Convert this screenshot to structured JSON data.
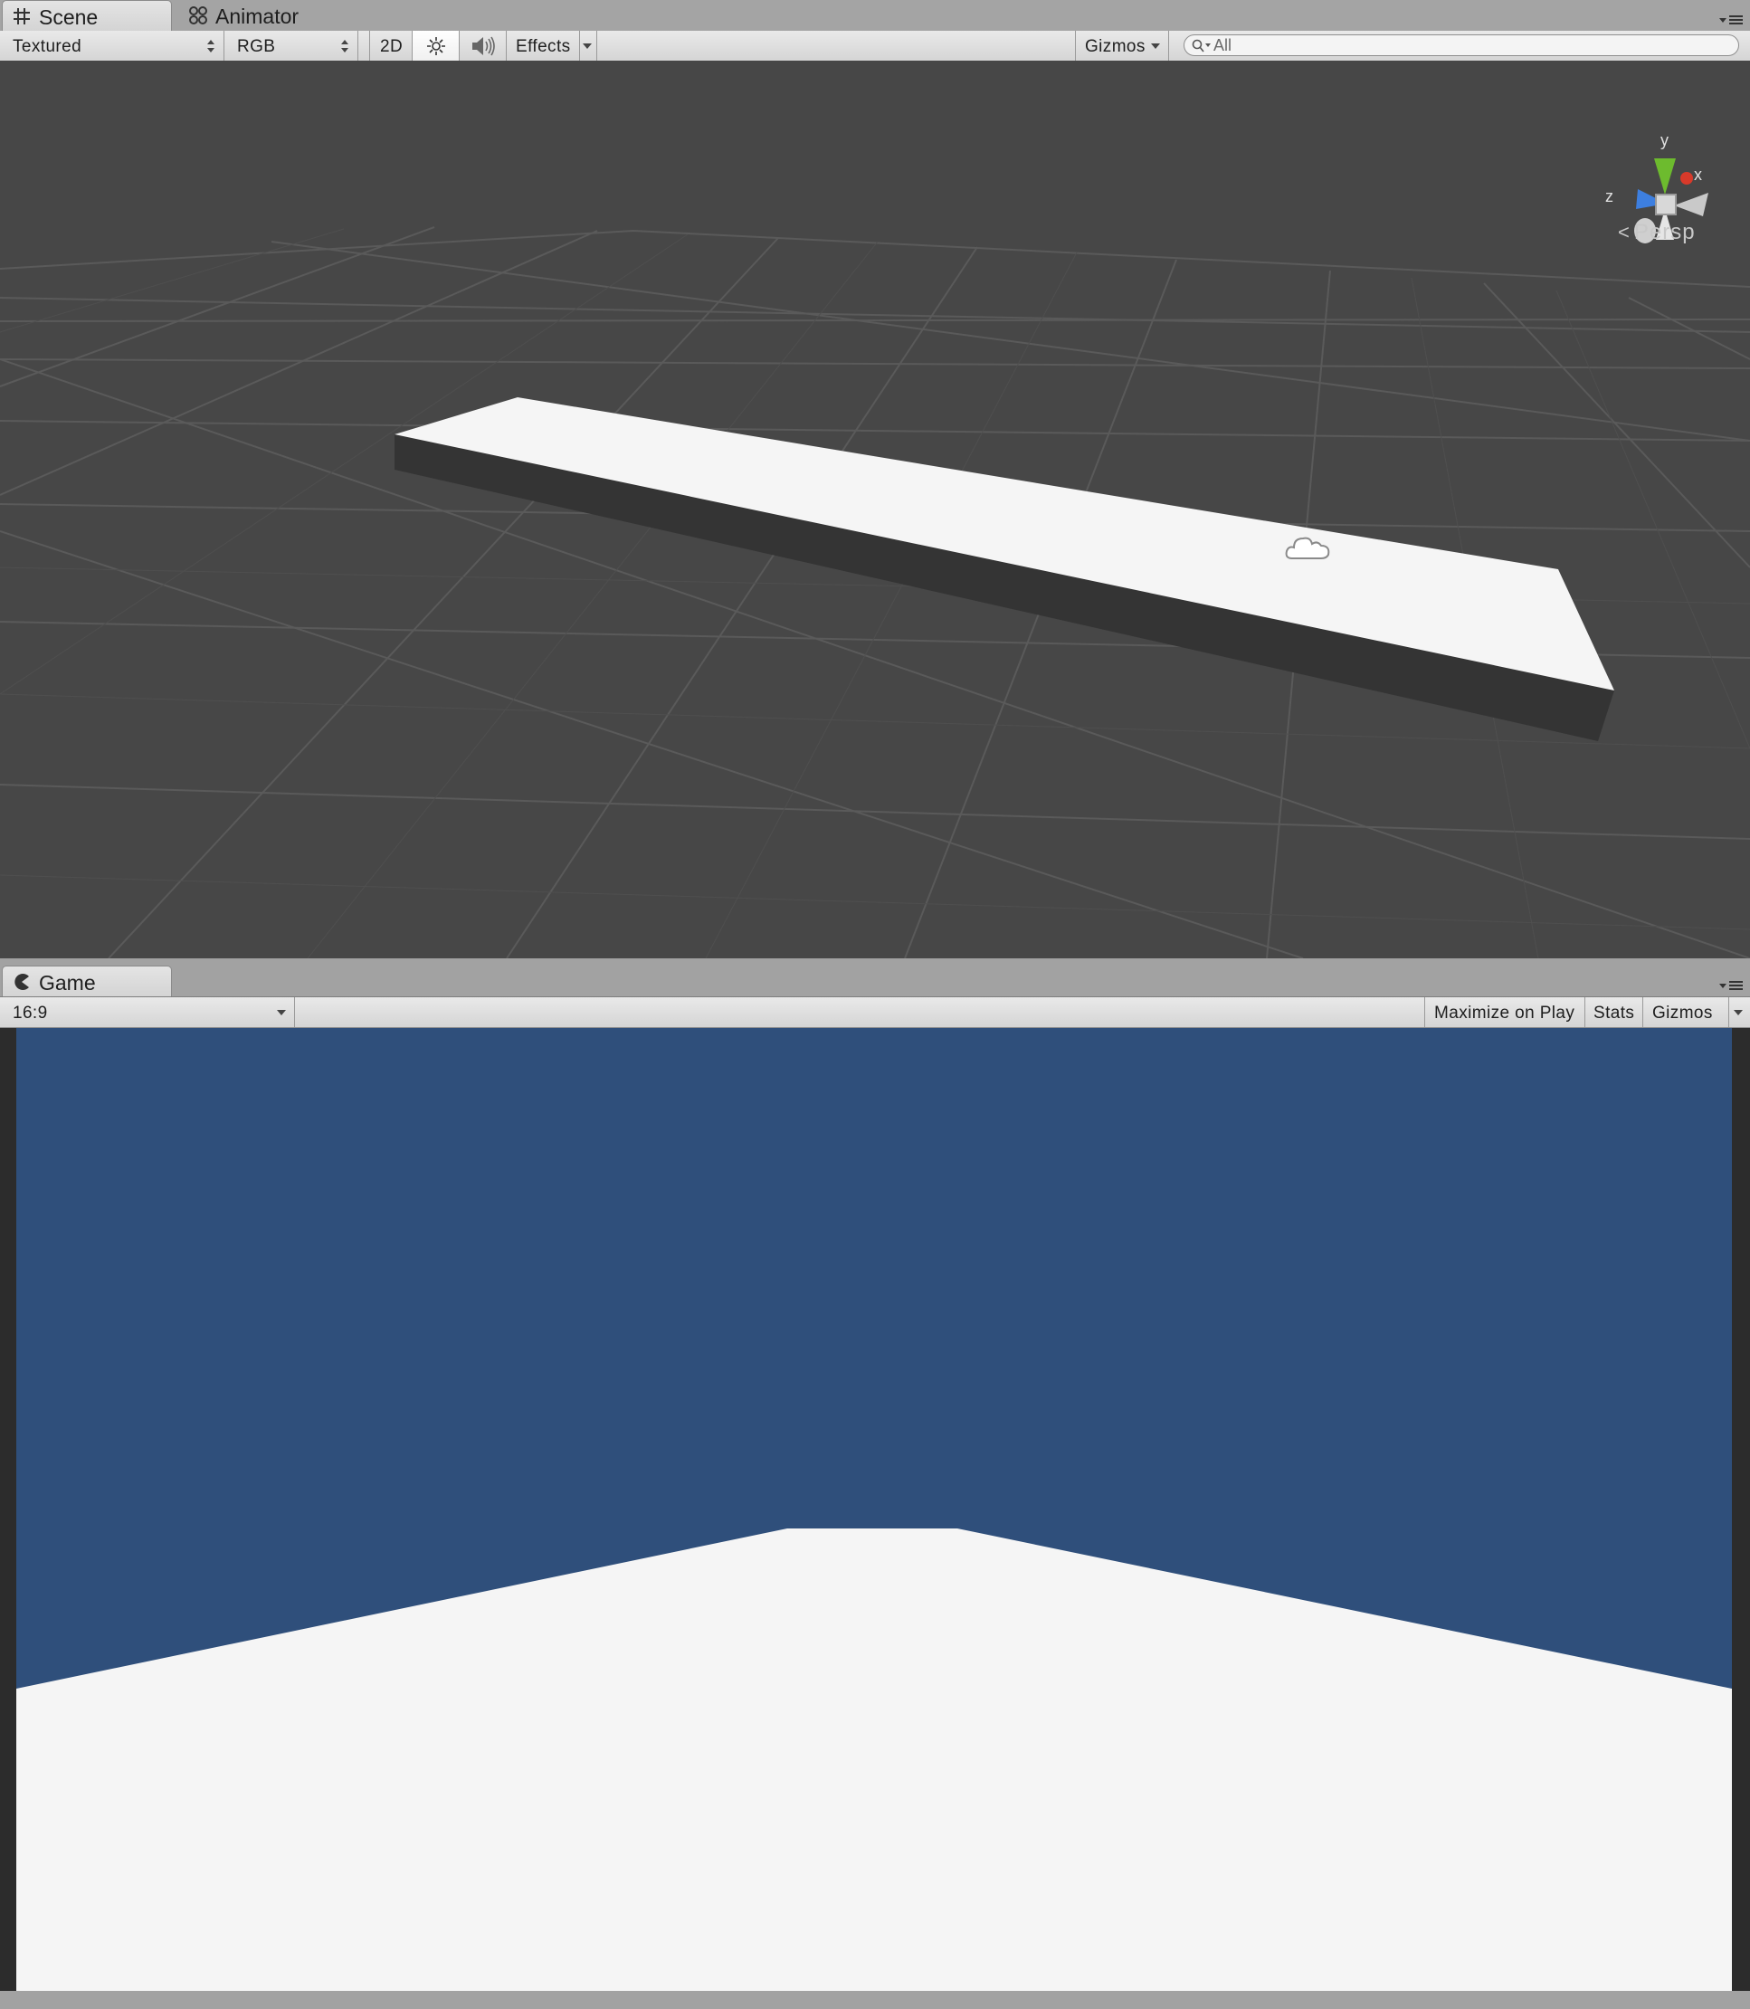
{
  "scene_tabs": {
    "scene": "Scene",
    "animator": "Animator"
  },
  "scene_toolbar": {
    "draw_mode": "Textured",
    "render_mode": "RGB",
    "mode_2d": "2D",
    "lighting_icon": "sun-icon",
    "audio_icon": "speaker-icon",
    "effects": "Effects",
    "gizmos": "Gizmos",
    "search_placeholder": "All"
  },
  "scene_view": {
    "projection_label": "Persp",
    "axis_labels": {
      "y": "y",
      "x": "x",
      "z": "z"
    },
    "background_color": "#474747",
    "platform_top_color": "#f5f5f5",
    "platform_side_color": "#333333"
  },
  "game_tabs": {
    "game": "Game"
  },
  "game_toolbar": {
    "aspect": "16:9",
    "maximize_on_play": "Maximize on Play",
    "stats": "Stats",
    "gizmos": "Gizmos"
  },
  "game_view": {
    "sky_color": "#2f4f7b",
    "ground_color": "#f5f5f5"
  }
}
